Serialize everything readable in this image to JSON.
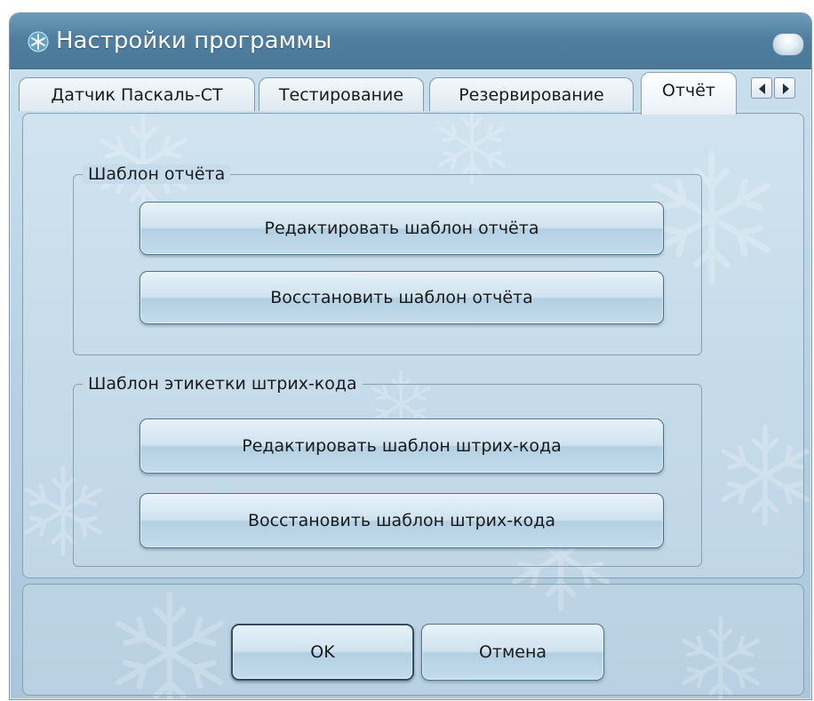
{
  "window": {
    "title": "Настройки программы",
    "icon": "snowflake-icon",
    "control_icon": "window-orb-icon"
  },
  "tabs": [
    {
      "label": "Датчик Паскаль-СТ",
      "active": false
    },
    {
      "label": "Тестирование",
      "active": false
    },
    {
      "label": "Резервирование",
      "active": false
    },
    {
      "label": "Отчёт",
      "active": true
    }
  ],
  "tab_scroll": {
    "left_icon": "arrow-left-icon",
    "right_icon": "arrow-right-icon"
  },
  "groups": {
    "report_template": {
      "legend": "Шаблон отчёта",
      "edit_label": "Редактировать шаблон отчёта",
      "restore_label": "Восстановить шаблон отчёта"
    },
    "barcode_template": {
      "legend": "Шаблон этикетки штрих-кода",
      "edit_label": "Редактировать шаблон штрих-кода",
      "restore_label": "Восстановить шаблон штрих-кода"
    }
  },
  "footer": {
    "ok_label": "OK",
    "cancel_label": "Отмена"
  },
  "colors": {
    "titlebar": "#4f7e9f",
    "window_bg": "#b6d1e3",
    "border": "#8aa0b2",
    "button_border": "#4c7591"
  }
}
